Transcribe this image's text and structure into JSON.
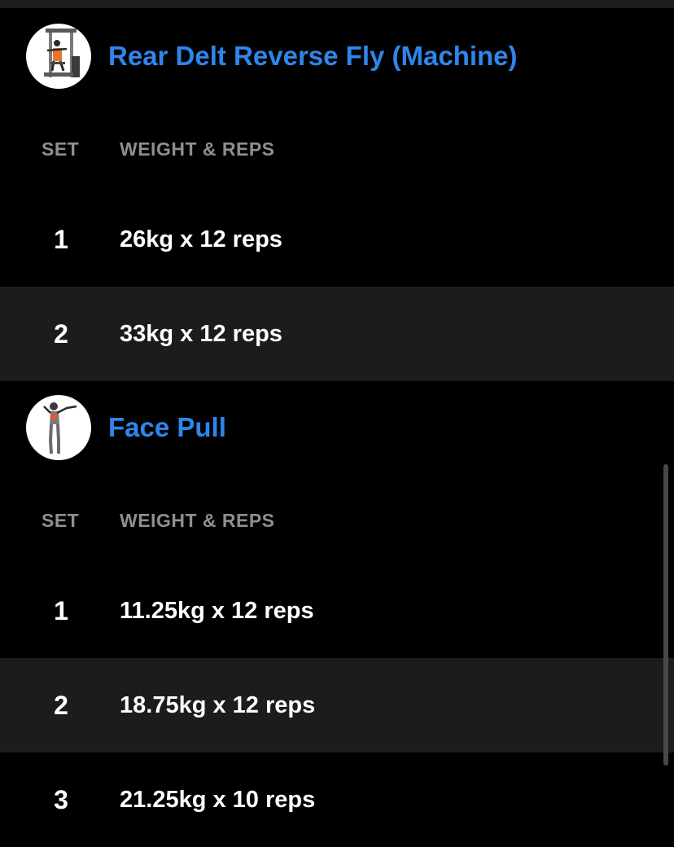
{
  "theme": {
    "background": "#000000",
    "row_alt_background": "#1c1c1e",
    "title_color": "#2f86ea",
    "header_color": "#8e8e93",
    "text_color": "#ffffff"
  },
  "columns": {
    "set": "SET",
    "weight_reps": "WEIGHT & REPS"
  },
  "exercises": [
    {
      "name": "Rear Delt Reverse Fly (Machine)",
      "icon": "rear-delt-machine-thumbnail",
      "sets": [
        {
          "num": "1",
          "value": "26kg x 12 reps"
        },
        {
          "num": "2",
          "value": "33kg x 12 reps"
        }
      ]
    },
    {
      "name": "Face Pull",
      "icon": "face-pull-thumbnail",
      "sets": [
        {
          "num": "1",
          "value": "11.25kg x 12 reps"
        },
        {
          "num": "2",
          "value": "18.75kg x 12 reps"
        },
        {
          "num": "3",
          "value": "21.25kg x 10 reps"
        }
      ]
    }
  ]
}
